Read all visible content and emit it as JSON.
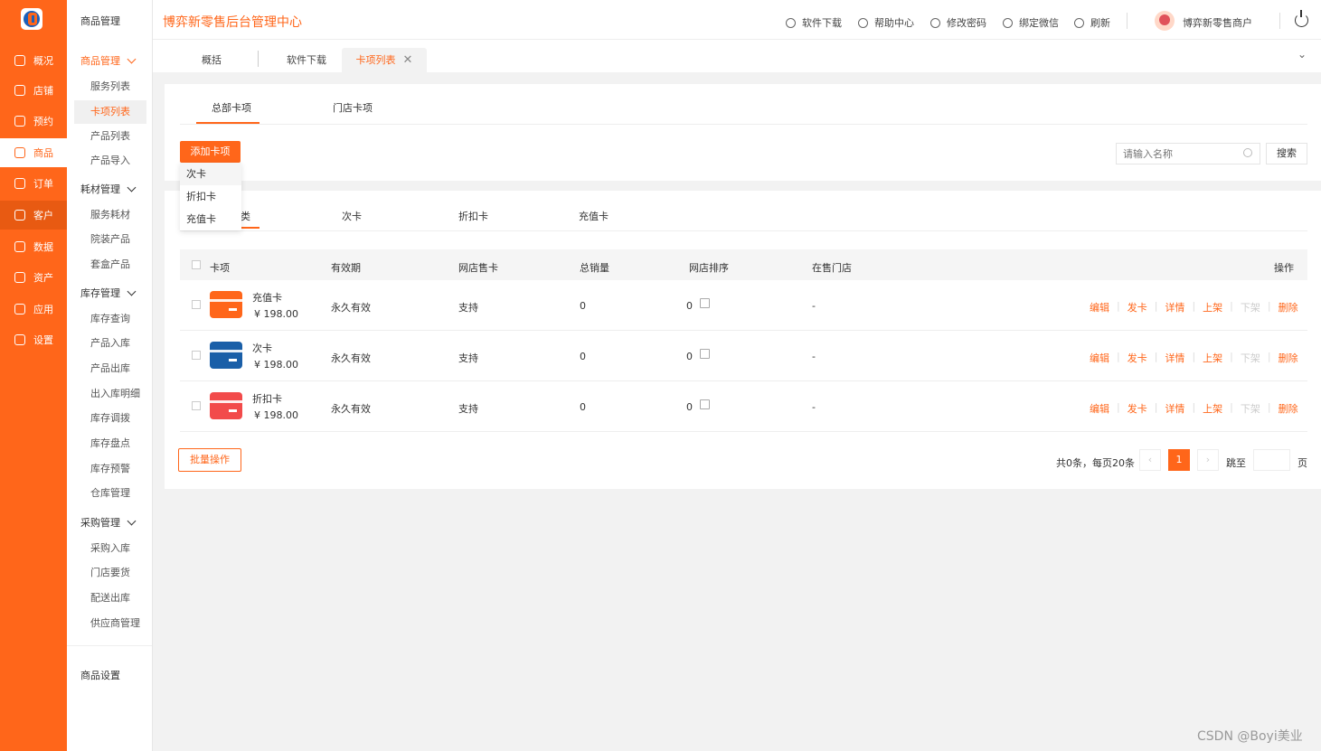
{
  "colors": {
    "accent": "#ff661a",
    "card_orange": "#ff661a",
    "card_blue": "#1a5fa8",
    "card_red": "#f24b4b"
  },
  "rail": {
    "items": [
      {
        "label": "概况",
        "icon": "diamond-icon"
      },
      {
        "label": "店铺",
        "icon": "store-icon"
      },
      {
        "label": "预约",
        "icon": "calendar-icon"
      },
      {
        "label": "商品",
        "icon": "goods-icon"
      },
      {
        "label": "订单",
        "icon": "order-icon"
      },
      {
        "label": "客户",
        "icon": "user-icon"
      },
      {
        "label": "数据",
        "icon": "data-icon"
      },
      {
        "label": "资产",
        "icon": "asset-icon"
      },
      {
        "label": "应用",
        "icon": "apps-icon"
      },
      {
        "label": "设置",
        "icon": "settings-icon"
      }
    ]
  },
  "side": {
    "title": "商品管理",
    "groups": [
      {
        "label": "商品管理",
        "items": [
          "服务列表",
          "卡项列表",
          "产品列表",
          "产品导入"
        ]
      },
      {
        "label": "耗材管理",
        "items": [
          "服务耗材",
          "院装产品",
          "套盒产品"
        ]
      },
      {
        "label": "库存管理",
        "items": [
          "库存查询",
          "产品入库",
          "产品出库",
          "出入库明细",
          "库存调拨",
          "库存盘点",
          "库存预警",
          "仓库管理"
        ]
      },
      {
        "label": "采购管理",
        "items": [
          "采购入库",
          "门店要货",
          "配送出库",
          "供应商管理"
        ]
      }
    ],
    "settings": "商品设置"
  },
  "header": {
    "title": "博弈新零售后台管理中心",
    "actions": [
      "软件下载",
      "帮助中心",
      "修改密码",
      "绑定微信",
      "刷新"
    ],
    "user": "博弈新零售商户"
  },
  "tabs": [
    "概括",
    "软件下载",
    "卡项列表"
  ],
  "content": {
    "top_tabs": [
      "总部卡项",
      "门店卡项"
    ],
    "add_button": "添加卡项",
    "dropdown": [
      "次卡",
      "折扣卡",
      "充值卡"
    ],
    "search_placeholder": "请输入名称",
    "search_button": "搜索",
    "sub_tabs": [
      "全部分类",
      "次卡",
      "折扣卡",
      "充值卡"
    ],
    "sub_tab_visible": "类",
    "columns": [
      "卡项",
      "有效期",
      "网店售卡",
      "总销量",
      "网店排序",
      "在售门店",
      "操作"
    ],
    "rows": [
      {
        "name": "充值卡",
        "price": "¥ 198.00",
        "validity": "永久有效",
        "online": "支持",
        "sales": "0",
        "sort": "0",
        "stores": "-",
        "color": "orange"
      },
      {
        "name": "次卡",
        "price": "¥ 198.00",
        "validity": "永久有效",
        "online": "支持",
        "sales": "0",
        "sort": "0",
        "stores": "-",
        "color": "blue"
      },
      {
        "name": "折扣卡",
        "price": "¥ 198.00",
        "validity": "永久有效",
        "online": "支持",
        "sales": "0",
        "sort": "0",
        "stores": "-",
        "color": "red"
      }
    ],
    "ops": [
      "编辑",
      "发卡",
      "详情",
      "上架",
      "下架",
      "删除"
    ],
    "batch": "批量操作",
    "pagination": {
      "total": "共0条，每页20条",
      "current": "1",
      "jump": "跳至",
      "page": "页"
    }
  },
  "watermark": "CSDN @Boyi美业"
}
